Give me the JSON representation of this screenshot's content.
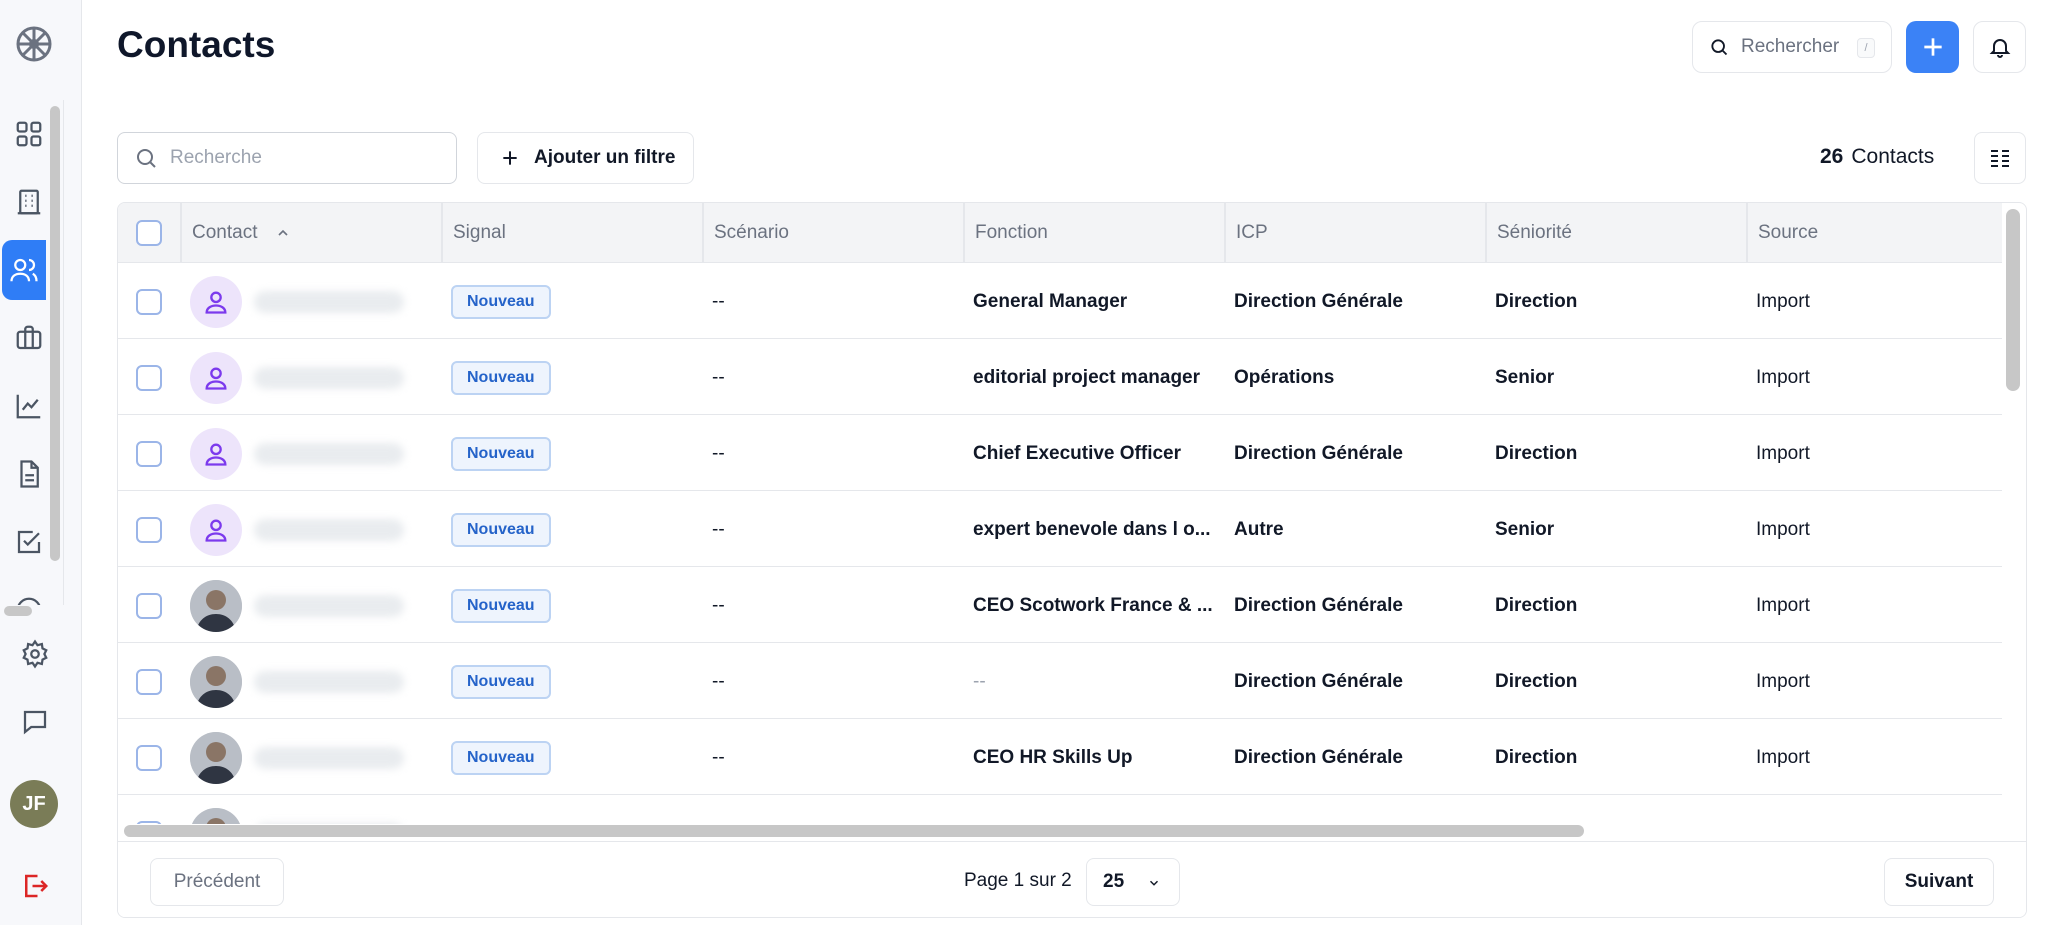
{
  "header": {
    "title": "Contacts",
    "search_placeholder": "Rechercher",
    "search_shortcut": "/"
  },
  "toolbar": {
    "search_placeholder": "Recherche",
    "filter_label": "Ajouter un filtre",
    "count_value": "26",
    "count_label": "Contacts"
  },
  "sidebar": {
    "items": [
      "grid-icon",
      "building-icon",
      "users-icon",
      "briefcase-icon",
      "chart-line-icon",
      "document-icon",
      "checkbox-icon"
    ],
    "active": "users-icon",
    "bottom": [
      "gear-icon",
      "chat-icon",
      "logout-icon"
    ],
    "avatar_initials": "JF"
  },
  "table": {
    "columns": [
      "Contact",
      "Signal",
      "Scénario",
      "Fonction",
      "ICP",
      "Séniorité",
      "Source"
    ],
    "sorted_column": "Contact",
    "rows": [
      {
        "avatar": "placeholder",
        "signal": "Nouveau",
        "scenario": "--",
        "fonction": "General Manager",
        "icp": "Direction Générale",
        "seniorite": "Direction",
        "source": "Import"
      },
      {
        "avatar": "placeholder",
        "signal": "Nouveau",
        "scenario": "--",
        "fonction": "editorial project manager",
        "icp": "Opérations",
        "seniorite": "Senior",
        "source": "Import"
      },
      {
        "avatar": "placeholder",
        "signal": "Nouveau",
        "scenario": "--",
        "fonction": "Chief Executive Officer",
        "icp": "Direction Générale",
        "seniorite": "Direction",
        "source": "Import"
      },
      {
        "avatar": "placeholder",
        "signal": "Nouveau",
        "scenario": "--",
        "fonction": "expert benevole dans l o...",
        "icp": "Autre",
        "seniorite": "Senior",
        "source": "Import"
      },
      {
        "avatar": "photo",
        "signal": "Nouveau",
        "scenario": "--",
        "fonction": "CEO Scotwork France & ...",
        "icp": "Direction Générale",
        "seniorite": "Direction",
        "source": "Import"
      },
      {
        "avatar": "photo",
        "signal": "Nouveau",
        "scenario": "--",
        "fonction": "--",
        "icp": "Direction Générale",
        "seniorite": "Direction",
        "source": "Import"
      },
      {
        "avatar": "photo",
        "signal": "Nouveau",
        "scenario": "--",
        "fonction": "CEO HR Skills Up",
        "icp": "Direction Générale",
        "seniorite": "Direction",
        "source": "Import"
      },
      {
        "avatar": "photo",
        "signal": "",
        "scenario": "",
        "fonction": "",
        "icp": "",
        "seniorite": "",
        "source": ""
      }
    ]
  },
  "pagination": {
    "prev_label": "Précédent",
    "page_info": "Page 1 sur 2",
    "page_size": "25",
    "next_label": "Suivant"
  },
  "colors": {
    "accent": "#3b82f6",
    "badge_text": "#2563c9",
    "badge_bg": "#eef4fd",
    "avatar_bg": "#ede4fb",
    "avatar_icon": "#7c3aed",
    "logout": "#dc2626"
  }
}
